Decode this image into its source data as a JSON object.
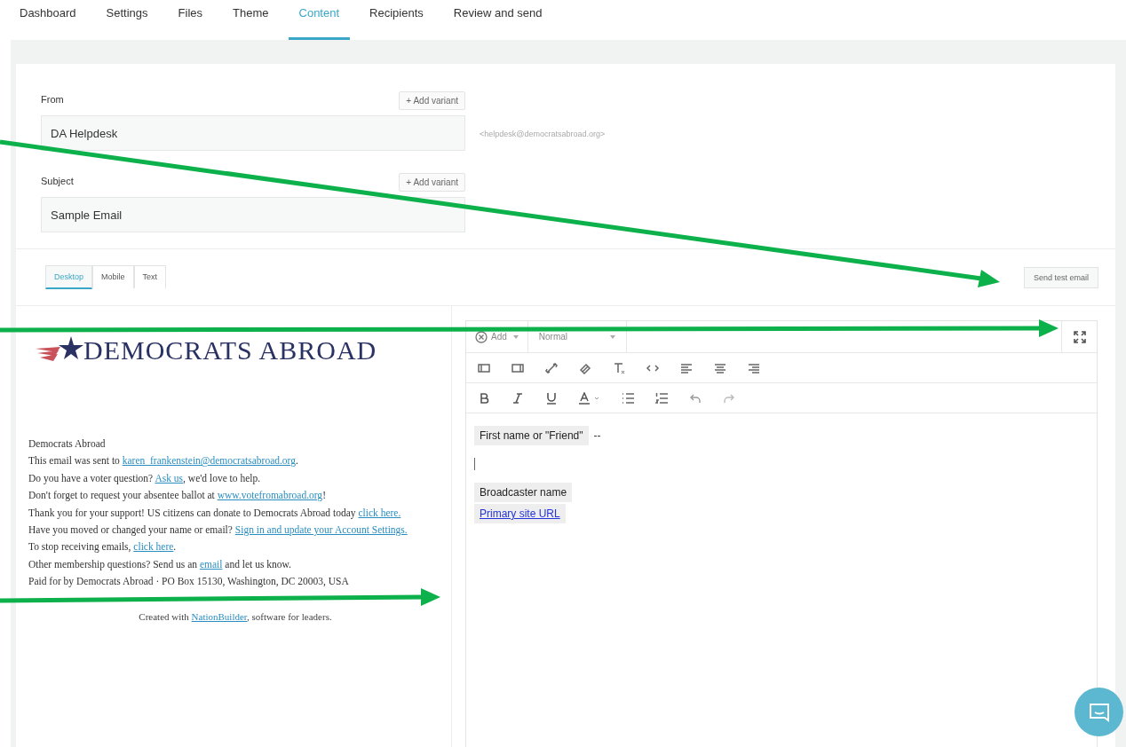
{
  "tabs": [
    {
      "label": "Dashboard",
      "selected": false
    },
    {
      "label": "Settings",
      "selected": false
    },
    {
      "label": "Files",
      "selected": false
    },
    {
      "label": "Theme",
      "selected": false
    },
    {
      "label": "Content",
      "selected": true
    },
    {
      "label": "Recipients",
      "selected": false
    },
    {
      "label": "Review and send",
      "selected": false
    }
  ],
  "from": {
    "label": "From",
    "button": "+ Add variant",
    "value": "DA Helpdesk",
    "address": "<helpdesk@democratsabroad.org>"
  },
  "subject": {
    "label": "Subject",
    "button": "+ Add variant",
    "value": "Sample Email"
  },
  "view_tabs": [
    {
      "label": "Desktop",
      "selected": true
    },
    {
      "label": "Mobile",
      "selected": false
    },
    {
      "label": "Text",
      "selected": false
    }
  ],
  "send_test_button": "Send test email",
  "preview": {
    "logo": "DEMOCRATS ABROAD",
    "lines": [
      [
        {
          "text": "Democrats Abroad",
          "link": false
        }
      ],
      [
        {
          "text": "This email was sent to ",
          "link": false
        },
        {
          "text": "karen_frankenstein@democratsabroad.org",
          "link": true
        },
        {
          "text": ".",
          "link": false
        }
      ],
      [
        {
          "text": "Do you have a voter question? ",
          "link": false
        },
        {
          "text": "Ask us",
          "link": true
        },
        {
          "text": ", we'd love to help.",
          "link": false
        }
      ],
      [
        {
          "text": "Don't forget to request your absentee ballot at ",
          "link": false
        },
        {
          "text": "www.votefromabroad.org",
          "link": true
        },
        {
          "text": "!",
          "link": false
        }
      ],
      [
        {
          "text": "Thank you for your support! US citizens can donate to Democrats Abroad today ",
          "link": false
        },
        {
          "text": "click here.",
          "link": true
        }
      ],
      [
        {
          "text": "Have you moved or changed your name or email? ",
          "link": false
        },
        {
          "text": "Sign in and update your Account Settings.",
          "link": true
        }
      ],
      [
        {
          "text": "To stop receiving emails, ",
          "link": false
        },
        {
          "text": "click here",
          "link": true
        },
        {
          "text": ".",
          "link": false
        }
      ],
      [
        {
          "text": "Other membership questions? Send us an ",
          "link": false
        },
        {
          "text": "email",
          "link": true
        },
        {
          "text": " and let us know.",
          "link": false
        }
      ],
      [
        {
          "text": "Paid for by Democrats Abroad · PO Box 15130, Washington, DC 20003, USA",
          "link": false
        }
      ]
    ],
    "footer": [
      {
        "text": "Created with ",
        "link": false
      },
      {
        "text": "NationBuilder",
        "link": true
      },
      {
        "text": ", software for leaders.",
        "link": false
      }
    ]
  },
  "editor": {
    "add_button": "Add",
    "style_select": "Normal",
    "content": [
      {
        "kind": "tag",
        "text": "First name or \"Friend\"",
        "after": "--"
      },
      {
        "kind": "cursor"
      },
      {
        "kind": "tag",
        "text": "Broadcaster name"
      },
      {
        "kind": "link_tag",
        "text": "Primary site URL"
      }
    ]
  }
}
